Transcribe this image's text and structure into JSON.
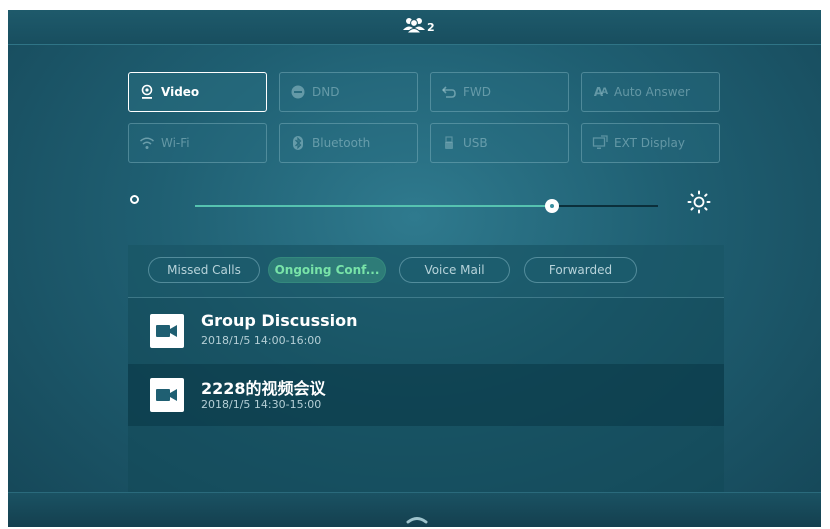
{
  "status_bar": {
    "icon": "conference-icon",
    "participant_count": "2"
  },
  "quick_settings": [
    {
      "id": "video",
      "label": "Video",
      "icon": "video-icon",
      "active": true
    },
    {
      "id": "dnd",
      "label": "DND",
      "icon": "dnd-icon",
      "active": false
    },
    {
      "id": "fwd",
      "label": "FWD",
      "icon": "forward-icon",
      "active": false
    },
    {
      "id": "auto-answer",
      "label": "Auto Answer",
      "icon": "auto-answer-icon",
      "active": false
    },
    {
      "id": "wifi",
      "label": "Wi-Fi",
      "icon": "wifi-icon",
      "active": false
    },
    {
      "id": "bluetooth",
      "label": "Bluetooth",
      "icon": "bluetooth-icon",
      "active": false
    },
    {
      "id": "usb",
      "label": "USB",
      "icon": "usb-icon",
      "active": false
    },
    {
      "id": "ext-display",
      "label": "EXT Display",
      "icon": "ext-display-icon",
      "active": false
    }
  ],
  "brightness": {
    "level": 0.77,
    "min_icon": "brightness-low-icon",
    "max_icon": "brightness-high-icon"
  },
  "tabs": [
    {
      "label": "Missed Calls",
      "active": false
    },
    {
      "label": "Ongoing Conf...",
      "active": true
    },
    {
      "label": "Voice Mail",
      "active": false
    },
    {
      "label": "Forwarded",
      "active": false
    }
  ],
  "conferences": [
    {
      "title": "Group Discussion",
      "time": "2018/1/5 14:00-16:00",
      "icon": "video-camera-icon"
    },
    {
      "title": "2228的视频会议",
      "time": "2018/1/5 14:30-15:00",
      "icon": "video-camera-icon"
    }
  ],
  "bottom_bar": {
    "icon": "chevron-up-icon"
  },
  "colors": {
    "background": "#1f5f72",
    "accent_green": "#78e3a8",
    "slider_fill": "#56c3b0",
    "text_primary": "#ffffff"
  }
}
